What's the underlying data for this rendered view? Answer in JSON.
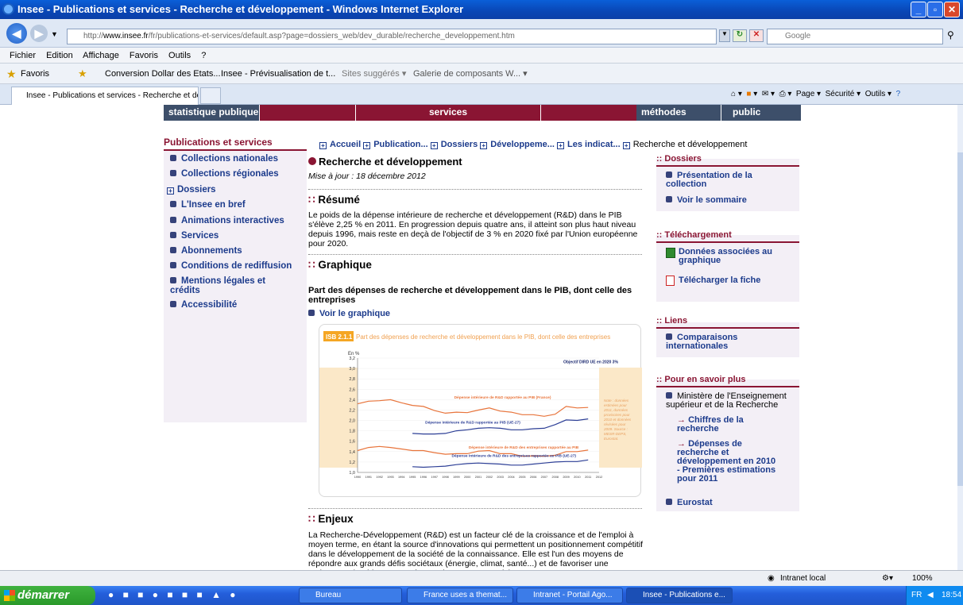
{
  "window": {
    "title": "Insee - Publications et services - Recherche et développement - Windows Internet Explorer"
  },
  "address": {
    "url_prefix": "http://",
    "url_domain": "www.insee.fr",
    "url_rest": "/fr/publications-et-services/default.asp?page=dossiers_web/dev_durable/recherche_developpement.htm",
    "search_placeholder": "Google"
  },
  "menu": [
    "Fichier",
    "Edition",
    "Affichage",
    "Favoris",
    "Outils",
    "?"
  ],
  "favorites": {
    "label": "Favoris",
    "items": [
      "Conversion Dollar des Etats...",
      "Insee - Prévisualisation de t...",
      "Sites suggérés ▾",
      "Galerie de composants W... ▾"
    ]
  },
  "tab": {
    "label": "Insee - Publications et services - Recherche et dévelo..."
  },
  "commands": [
    "Page ▾",
    "Sécurité ▾",
    "Outils ▾"
  ],
  "site_nav": [
    "statistique publique",
    "services",
    "méthodes",
    "public"
  ],
  "leftnav": {
    "title": "Publications et services",
    "items": [
      "Collections nationales",
      "Collections régionales",
      "Dossiers",
      "L'Insee en bref",
      "Animations interactives",
      "Services",
      "Abonnements",
      "Conditions de rediffusion",
      "Mentions légales et crédits",
      "Accessibilité"
    ]
  },
  "breadcrumb": [
    "Accueil",
    "Publication...",
    "Dossiers",
    "Développeme...",
    "Les indicat...",
    "Recherche et développement"
  ],
  "main": {
    "title": "Recherche et développement",
    "updated": "Mise à jour : 18 décembre 2012",
    "resume_heading": "Résumé",
    "resume_text": "Le poids de la dépense intérieure de recherche et développement (R&D) dans le PIB s'élève 2,25 % en 2011. En progression depuis quatre ans, il atteint son plus haut niveau depuis 1996, mais reste en deçà de l'objectif de 3 % en 2020 fixé par l'Union européenne pour 2020.",
    "graph_heading": "Graphique",
    "graph_caption": "Part des dépenses de recherche et développement dans le PIB, dont celle des entreprises",
    "view_graph": "Voir le graphique",
    "enjeux_heading": "Enjeux",
    "enjeux_text": "La Recherche-Développement (R&D) est un facteur clé de la croissance et de l'emploi à moyen terme, en étant la source d'innovations qui permettent un positionnement compétitif dans le développement de la société de la connaissance. Elle est l'un des moyens de répondre aux grands défis sociétaux (énergie, climat, santé...) et de favoriser une croissance durable et une « économie verte ». Le suivi"
  },
  "chart_data": {
    "type": "line",
    "badge": "ISB 2.1.1",
    "title": "Part des dépenses de recherche et développement dans le PIB, dont celle des entreprises",
    "ylabel": "En %",
    "ylim": [
      1.0,
      3.2
    ],
    "yticks": [
      "3,2",
      "3,0",
      "2,8",
      "2,6",
      "2,4",
      "2,2",
      "2,0",
      "1,8",
      "1,6",
      "1,4",
      "1,2",
      "1,0"
    ],
    "x": [
      "1990",
      "1991",
      "1992",
      "1993",
      "1994",
      "1995",
      "1996",
      "1997",
      "1998",
      "1999",
      "2000",
      "2001",
      "2002",
      "2003",
      "2004",
      "2005",
      "2006",
      "2007",
      "2008",
      "2009",
      "2010",
      "2011",
      "2012"
    ],
    "objective_label": "Objectif DIRD UE en 2020 3%",
    "objective_value": 3.0,
    "note": "Note : données estimées pour 2011, données provisoires pour 2010 et données révisées pour 2009. Source : MESR-DEPS, Eurostat.",
    "series": [
      {
        "name": "Dépense intérieure de R&D rapportée au PIB (France)",
        "color": "#e8743b",
        "values": [
          2.32,
          2.37,
          2.38,
          2.4,
          2.34,
          2.29,
          2.27,
          2.19,
          2.14,
          2.16,
          2.15,
          2.2,
          2.24,
          2.18,
          2.16,
          2.11,
          2.11,
          2.08,
          2.12,
          2.27,
          2.24,
          2.25,
          null
        ]
      },
      {
        "name": "Dépense intérieure de R&D rapportée au PIB (UE-27)",
        "color": "#2d3f96",
        "values": [
          null,
          null,
          null,
          null,
          null,
          1.75,
          1.74,
          1.74,
          1.75,
          1.8,
          1.82,
          1.85,
          1.86,
          1.85,
          1.82,
          1.82,
          1.84,
          1.85,
          1.92,
          2.01,
          2.0,
          2.03,
          null
        ]
      },
      {
        "name": "Dépense intérieure de R&D des entreprises rapportée au PIB",
        "color": "#e8743b",
        "values": [
          1.42,
          1.48,
          1.5,
          1.48,
          1.45,
          1.42,
          1.42,
          1.38,
          1.35,
          1.36,
          1.36,
          1.41,
          1.42,
          1.36,
          1.36,
          1.31,
          1.32,
          1.31,
          1.33,
          1.4,
          1.4,
          1.43,
          null
        ]
      },
      {
        "name": "Dépense intérieure de R&D des entreprises rapportée au PIB (UE-27)",
        "color": "#2d3f96",
        "values": [
          null,
          null,
          null,
          null,
          null,
          1.11,
          1.1,
          1.11,
          1.12,
          1.15,
          1.17,
          1.18,
          1.17,
          1.16,
          1.14,
          1.14,
          1.16,
          1.18,
          1.2,
          1.21,
          1.21,
          1.24,
          null
        ]
      }
    ]
  },
  "right": {
    "dossiers": {
      "title": ":: Dossiers",
      "items": [
        "Présentation de la collection",
        "Voir le sommaire"
      ]
    },
    "telechargement": {
      "title": ":: Téléchargement",
      "items": [
        "Données associées au graphique",
        "Télécharger la fiche"
      ]
    },
    "liens": {
      "title": ":: Liens",
      "items": [
        "Comparaisons internationales"
      ]
    },
    "savoir": {
      "title": ":: Pour en savoir plus",
      "intro": "Ministère de l'Enseignement supérieur et de la Recherche",
      "sub": [
        "Chiffres de la recherche",
        "Dépenses de recherche et développement en 2010 - Premières estimations pour 2011"
      ],
      "last": "Eurostat"
    }
  },
  "status": {
    "zone": "Intranet local",
    "zoom": "100%"
  },
  "taskbar": {
    "start": "démarrer",
    "tasks": [
      "Bureau",
      "France uses a themat...",
      "Intranet - Portail Ago...",
      "Insee - Publications e..."
    ],
    "lang": "FR",
    "time": "18:54"
  }
}
